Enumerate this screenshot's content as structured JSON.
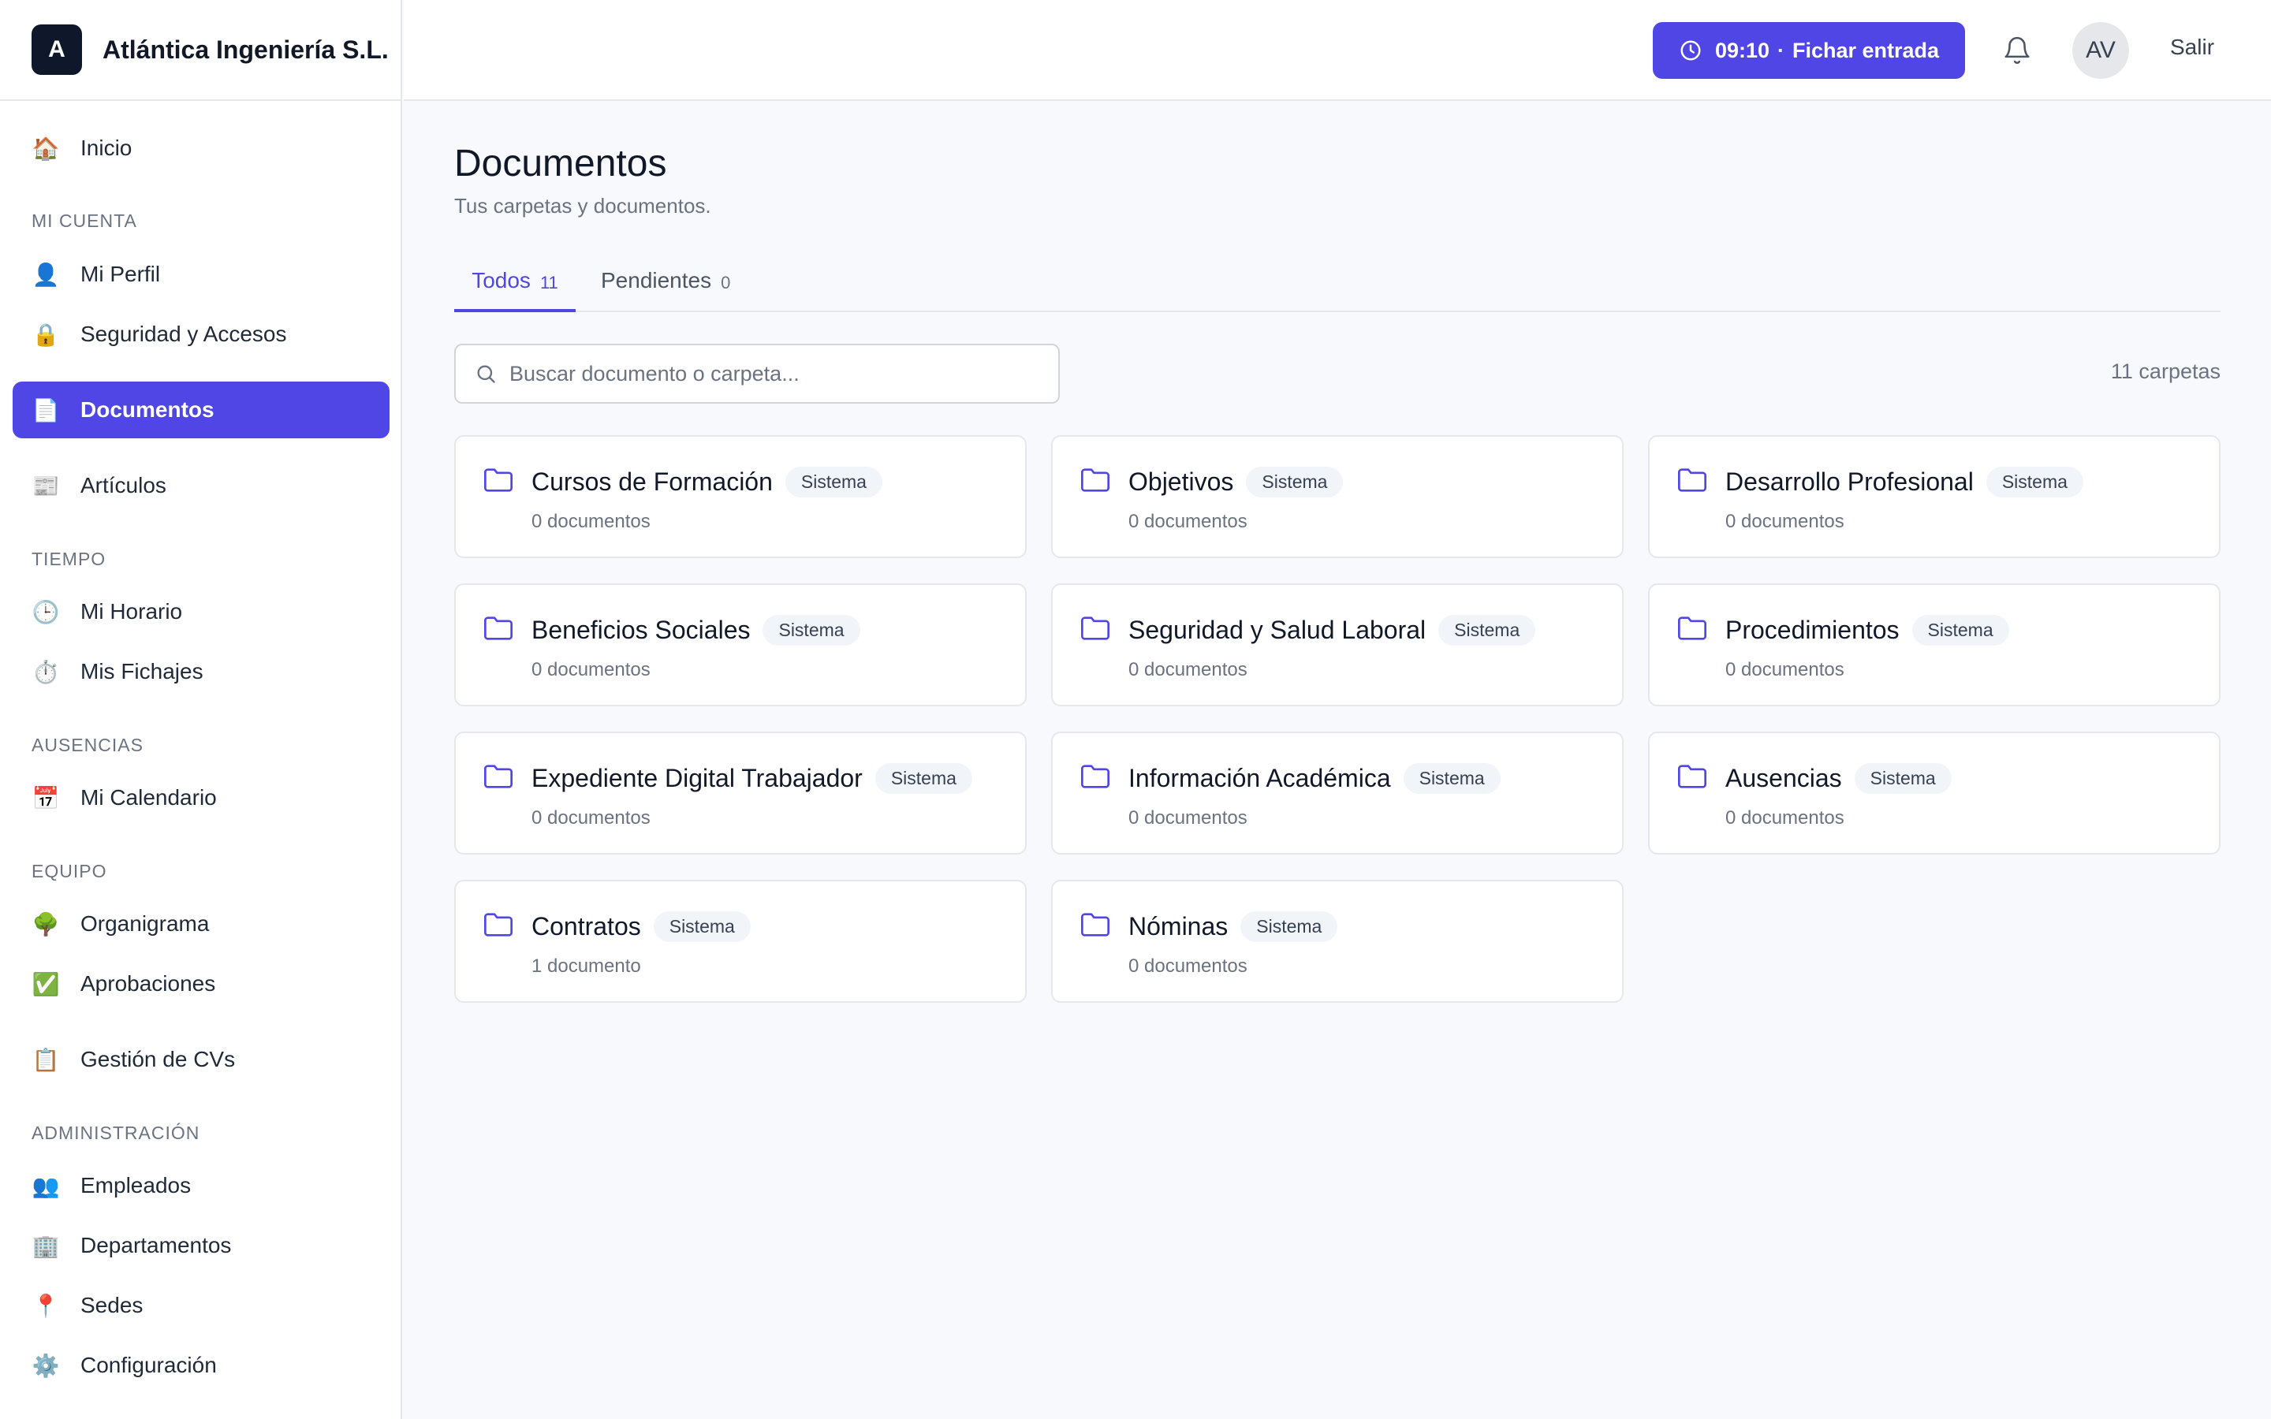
{
  "brand": {
    "logo": "A",
    "name": "Atlántica Ingeniería S.L."
  },
  "sidebar": {
    "items": [
      {
        "label": "Inicio",
        "icon": "🏠"
      },
      {
        "label": "Mi Perfil",
        "icon": "👤"
      },
      {
        "label": "Seguridad y Accesos",
        "icon": "🔒"
      },
      {
        "label": "Documentos",
        "icon": "📄"
      },
      {
        "label": "Artículos",
        "icon": "📰"
      },
      {
        "label": "Mi Horario",
        "icon": "🕒"
      },
      {
        "label": "Mis Fichajes",
        "icon": "⏱️"
      },
      {
        "label": "Mi Calendario",
        "icon": "📅"
      },
      {
        "label": "Organigrama",
        "icon": "🌳"
      },
      {
        "label": "Aprobaciones",
        "icon": "✅"
      },
      {
        "label": "Gestión de CVs",
        "icon": "📋"
      },
      {
        "label": "Empleados",
        "icon": "👥"
      },
      {
        "label": "Departamentos",
        "icon": "🏢"
      },
      {
        "label": "Sedes",
        "icon": "📍"
      },
      {
        "label": "Configuración",
        "icon": "⚙️"
      }
    ],
    "sections": {
      "account": "MI CUENTA",
      "time": "TIEMPO",
      "absences": "AUSENCIAS",
      "team": "EQUIPO",
      "admin": "ADMINISTRACIÓN"
    }
  },
  "header": {
    "clock_time": "09:10",
    "clock_sep": "·",
    "clock_action": "Fichar entrada",
    "avatar": "AV",
    "logout": "Salir"
  },
  "main": {
    "title": "Documentos",
    "subtitle": "Tus carpetas y documentos.",
    "tabs": [
      {
        "label": "Todos",
        "count": "11"
      },
      {
        "label": "Pendientes",
        "count": "0"
      }
    ],
    "search": {
      "placeholder": "Buscar documento o carpeta...",
      "value": ""
    },
    "folder_count": "11 carpetas",
    "folders": [
      {
        "name": "Cursos de Formación",
        "badge": "Sistema",
        "docs": "0 documentos"
      },
      {
        "name": "Objetivos",
        "badge": "Sistema",
        "docs": "0 documentos"
      },
      {
        "name": "Desarrollo Profesional",
        "badge": "Sistema",
        "docs": "0 documentos"
      },
      {
        "name": "Beneficios Sociales",
        "badge": "Sistema",
        "docs": "0 documentos"
      },
      {
        "name": "Seguridad y Salud Laboral",
        "badge": "Sistema",
        "docs": "0 documentos"
      },
      {
        "name": "Procedimientos",
        "badge": "Sistema",
        "docs": "0 documentos"
      },
      {
        "name": "Expediente Digital Trabajador",
        "badge": "Sistema",
        "docs": "0 documentos"
      },
      {
        "name": "Información Académica",
        "badge": "Sistema",
        "docs": "0 documentos"
      },
      {
        "name": "Ausencias",
        "badge": "Sistema",
        "docs": "0 documentos"
      },
      {
        "name": "Contratos",
        "badge": "Sistema",
        "docs": "1 documento"
      },
      {
        "name": "Nóminas",
        "badge": "Sistema",
        "docs": "0 documentos"
      }
    ]
  },
  "colors": {
    "accent": "#4f46e5",
    "folder_icon": "#4f46e5",
    "brand_logo_bg": "#0f172a"
  }
}
